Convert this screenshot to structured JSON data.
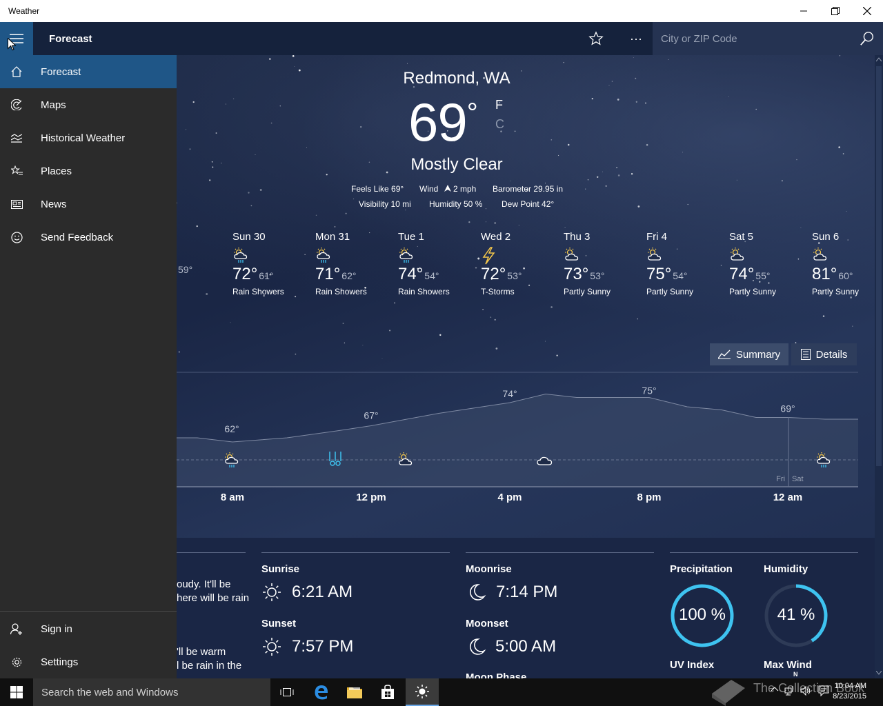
{
  "window": {
    "title": "Weather"
  },
  "appbar": {
    "title": "Forecast",
    "search_placeholder": "City or ZIP Code",
    "more_label": "···"
  },
  "nav": {
    "items": [
      {
        "label": "Forecast",
        "icon": "home-icon"
      },
      {
        "label": "Maps",
        "icon": "radar-icon"
      },
      {
        "label": "Historical Weather",
        "icon": "chart-icon"
      },
      {
        "label": "Places",
        "icon": "star-list-icon"
      },
      {
        "label": "News",
        "icon": "news-icon"
      },
      {
        "label": "Send Feedback",
        "icon": "smiley-icon"
      }
    ],
    "bottom": [
      {
        "label": "Sign in",
        "icon": "person-add-icon"
      },
      {
        "label": "Settings",
        "icon": "gear-icon"
      }
    ]
  },
  "current": {
    "location": "Redmond, WA",
    "temperature": "69",
    "degree": "°",
    "unit_f": "F",
    "unit_c": "C",
    "condition": "Mostly Clear",
    "feels_like": "Feels Like  69°",
    "wind_label": "Wind",
    "wind_value": "2 mph",
    "barometer": "Barometer  29.95 in",
    "visibility": "Visibility  10 mi",
    "humidity": "Humidity  50 %",
    "dew_point": "Dew Point  42°"
  },
  "daily": [
    {
      "day": "",
      "hi": "",
      "lo": "59°",
      "cond": "",
      "icon": ""
    },
    {
      "day": "Sun 30",
      "hi": "72°",
      "lo": "61°",
      "cond": "Rain Showers",
      "icon": "rain-showers-icon"
    },
    {
      "day": "Mon 31",
      "hi": "71°",
      "lo": "62°",
      "cond": "Rain Showers",
      "icon": "rain-showers-icon"
    },
    {
      "day": "Tue 1",
      "hi": "74°",
      "lo": "54°",
      "cond": "Rain Showers",
      "icon": "rain-showers-icon"
    },
    {
      "day": "Wed 2",
      "hi": "72°",
      "lo": "53°",
      "cond": "T-Storms",
      "icon": "lightning-icon"
    },
    {
      "day": "Thu 3",
      "hi": "73°",
      "lo": "53°",
      "cond": "Partly Sunny",
      "icon": "partly-sunny-icon"
    },
    {
      "day": "Fri 4",
      "hi": "75°",
      "lo": "54°",
      "cond": "Partly Sunny",
      "icon": "partly-sunny-icon"
    },
    {
      "day": "Sat 5",
      "hi": "74°",
      "lo": "55°",
      "cond": "Partly Sunny",
      "icon": "partly-sunny-icon"
    },
    {
      "day": "Sun 6",
      "hi": "81°",
      "lo": "60°",
      "cond": "Partly Sunny",
      "icon": "partly-sunny-icon"
    }
  ],
  "hourly_toggle": {
    "summary": "Summary",
    "details": "Details",
    "selected": "Summary"
  },
  "hourly": {
    "temp_labels": [
      "62°",
      "67°",
      "74°",
      "75°",
      "69°"
    ],
    "time_labels": [
      "8 am",
      "12 pm",
      "4 pm",
      "8 pm",
      "12 am"
    ],
    "day_divider": [
      "Fri",
      "Sat"
    ]
  },
  "chart_data": {
    "type": "area",
    "title": "",
    "xlabel": "",
    "ylabel": "",
    "x": [
      "8 am",
      "12 pm",
      "4 pm",
      "8 pm",
      "12 am"
    ],
    "series": [
      {
        "values": [
          62,
          67,
          74,
          75,
          69
        ]
      }
    ],
    "grid": false
  },
  "summary_text": {
    "line1": "oudy. It'll be",
    "line2": "here will be rain",
    "line3": "'ll be warm",
    "line4": "l be rain in the"
  },
  "sun": {
    "sunrise_label": "Sunrise",
    "sunrise": "6:21 AM",
    "sunset_label": "Sunset",
    "sunset": "7:57 PM"
  },
  "moon": {
    "moonrise_label": "Moonrise",
    "moonrise": "7:14 PM",
    "moonset_label": "Moonset",
    "moonset": "5:00 AM",
    "phase_label": "Moon Phase"
  },
  "stats": {
    "precip_label": "Precipitation",
    "precip_value": "100 %",
    "precip_fraction": 1.0,
    "humidity_label": "Humidity",
    "humidity_value": "41 %",
    "humidity_fraction": 0.41,
    "uv_label": "UV Index",
    "wind_label": "Max Wind",
    "wind_compass": "N"
  },
  "taskbar": {
    "search_placeholder": "Search the web and Windows",
    "time": "10:04 AM",
    "date": "8/23/2015",
    "watermark": "The Collection Book"
  },
  "colors": {
    "accent": "#1f5687",
    "ring": "#3ec3f0",
    "drawer": "#2b2b2b"
  }
}
